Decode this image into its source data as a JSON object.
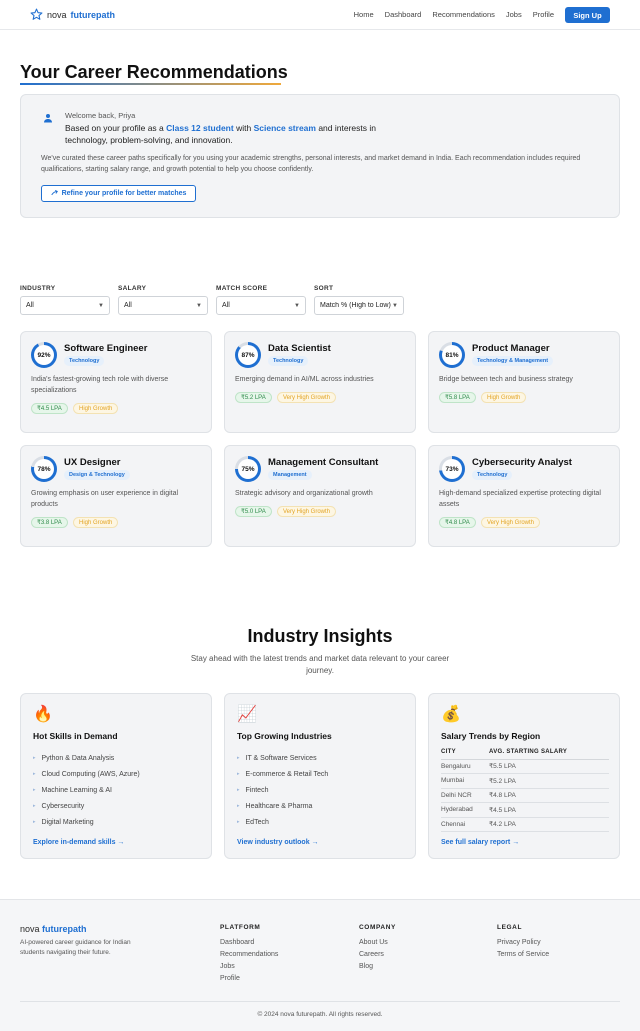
{
  "brand": {
    "part1": "nova",
    "part2": "futurepath"
  },
  "nav": {
    "links": [
      "Home",
      "Dashboard",
      "Recommendations",
      "Jobs",
      "Profile"
    ],
    "signup": "Sign Up"
  },
  "header": {
    "title": "Your Career Recommendations",
    "welcome": "Welcome back, Priya",
    "profile_pre": "Based on your profile as a",
    "profile_class": "Class 12 student",
    "profile_mid": "with",
    "profile_stream": "Science stream",
    "profile_post": "and interests in technology, problem-solving, and innovation.",
    "description": "We've curated these career paths specifically for you using your academic strengths, personal interests, and market demand in India. Each recommendation includes required qualifications, starting salary range, and growth potential to help you choose confidently.",
    "refine_button": "Refine your profile for better matches"
  },
  "filters": [
    {
      "label": "INDUSTRY",
      "value": "All"
    },
    {
      "label": "SALARY",
      "value": "All"
    },
    {
      "label": "MATCH SCORE",
      "value": "All"
    },
    {
      "label": "SORT",
      "value": "Match % (High to Low)"
    }
  ],
  "careers": [
    {
      "title": "Software Engineer",
      "match": 92,
      "match_label": "92%",
      "tag": "Technology",
      "desc": "India's fastest-growing tech role with diverse specializations",
      "salary": "₹4.5 LPA",
      "growth": "High Growth"
    },
    {
      "title": "Data Scientist",
      "match": 87,
      "match_label": "87%",
      "tag": "Technology",
      "desc": "Emerging demand in AI/ML across industries",
      "salary": "₹5.2 LPA",
      "growth": "Very High Growth"
    },
    {
      "title": "Product Manager",
      "match": 81,
      "match_label": "81%",
      "tag": "Technology & Management",
      "desc": "Bridge between tech and business strategy",
      "salary": "₹5.8 LPA",
      "growth": "High Growth"
    },
    {
      "title": "UX Designer",
      "match": 78,
      "match_label": "78%",
      "tag": "Design & Technology",
      "desc": "Growing emphasis on user experience in digital products",
      "salary": "₹3.8 LPA",
      "growth": "High Growth"
    },
    {
      "title": "Management Consultant",
      "match": 75,
      "match_label": "75%",
      "tag": "Management",
      "desc": "Strategic advisory and organizational growth",
      "salary": "₹5.0 LPA",
      "growth": "Very High Growth"
    },
    {
      "title": "Cybersecurity Analyst",
      "match": 73,
      "match_label": "73%",
      "tag": "Technology",
      "desc": "High-demand specialized expertise protecting digital assets",
      "salary": "₹4.8 LPA",
      "growth": "Very High Growth"
    }
  ],
  "insights": {
    "title": "Industry Insights",
    "subtitle": "Stay ahead with the latest trends and market data relevant to your career journey.",
    "skills": {
      "icon": "fire-icon",
      "title": "Hot Skills in Demand",
      "items": [
        "Python & Data Analysis",
        "Cloud Computing (AWS, Azure)",
        "Machine Learning & AI",
        "Cybersecurity",
        "Digital Marketing"
      ],
      "link": "Explore in-demand skills →"
    },
    "industries": {
      "icon": "chart-increasing-icon",
      "title": "Top Growing Industries",
      "items": [
        "IT & Software Services",
        "E-commerce & Retail Tech",
        "Fintech",
        "Healthcare & Pharma",
        "EdTech"
      ],
      "link": "View industry outlook →"
    },
    "salary": {
      "icon": "money-bag-icon",
      "title": "Salary Trends by Region",
      "col_city": "CITY",
      "col_salary": "AVG. STARTING SALARY",
      "rows": [
        {
          "city": "Bengaluru",
          "salary": "₹5.5 LPA"
        },
        {
          "city": "Mumbai",
          "salary": "₹5.2 LPA"
        },
        {
          "city": "Delhi NCR",
          "salary": "₹4.8 LPA"
        },
        {
          "city": "Hyderabad",
          "salary": "₹4.5 LPA"
        },
        {
          "city": "Chennai",
          "salary": "₹4.2 LPA"
        }
      ],
      "link": "See full salary report →"
    }
  },
  "footer": {
    "tagline": "AI-powered career guidance for Indian students navigating their future.",
    "platform": {
      "heading": "PLATFORM",
      "links": [
        "Dashboard",
        "Recommendations",
        "Jobs",
        "Profile"
      ]
    },
    "company": {
      "heading": "COMPANY",
      "links": [
        "About Us",
        "Careers",
        "Blog"
      ]
    },
    "legal": {
      "heading": "LEGAL",
      "links": [
        "Privacy Policy",
        "Terms of Service"
      ]
    },
    "copyright": "© 2024 nova futurepath. All rights reserved."
  },
  "colors": {
    "accent": "#1f6fd1",
    "gold": "#f0a93b",
    "salary_green": "#2e8b4a",
    "growth_amber": "#e3a424"
  }
}
